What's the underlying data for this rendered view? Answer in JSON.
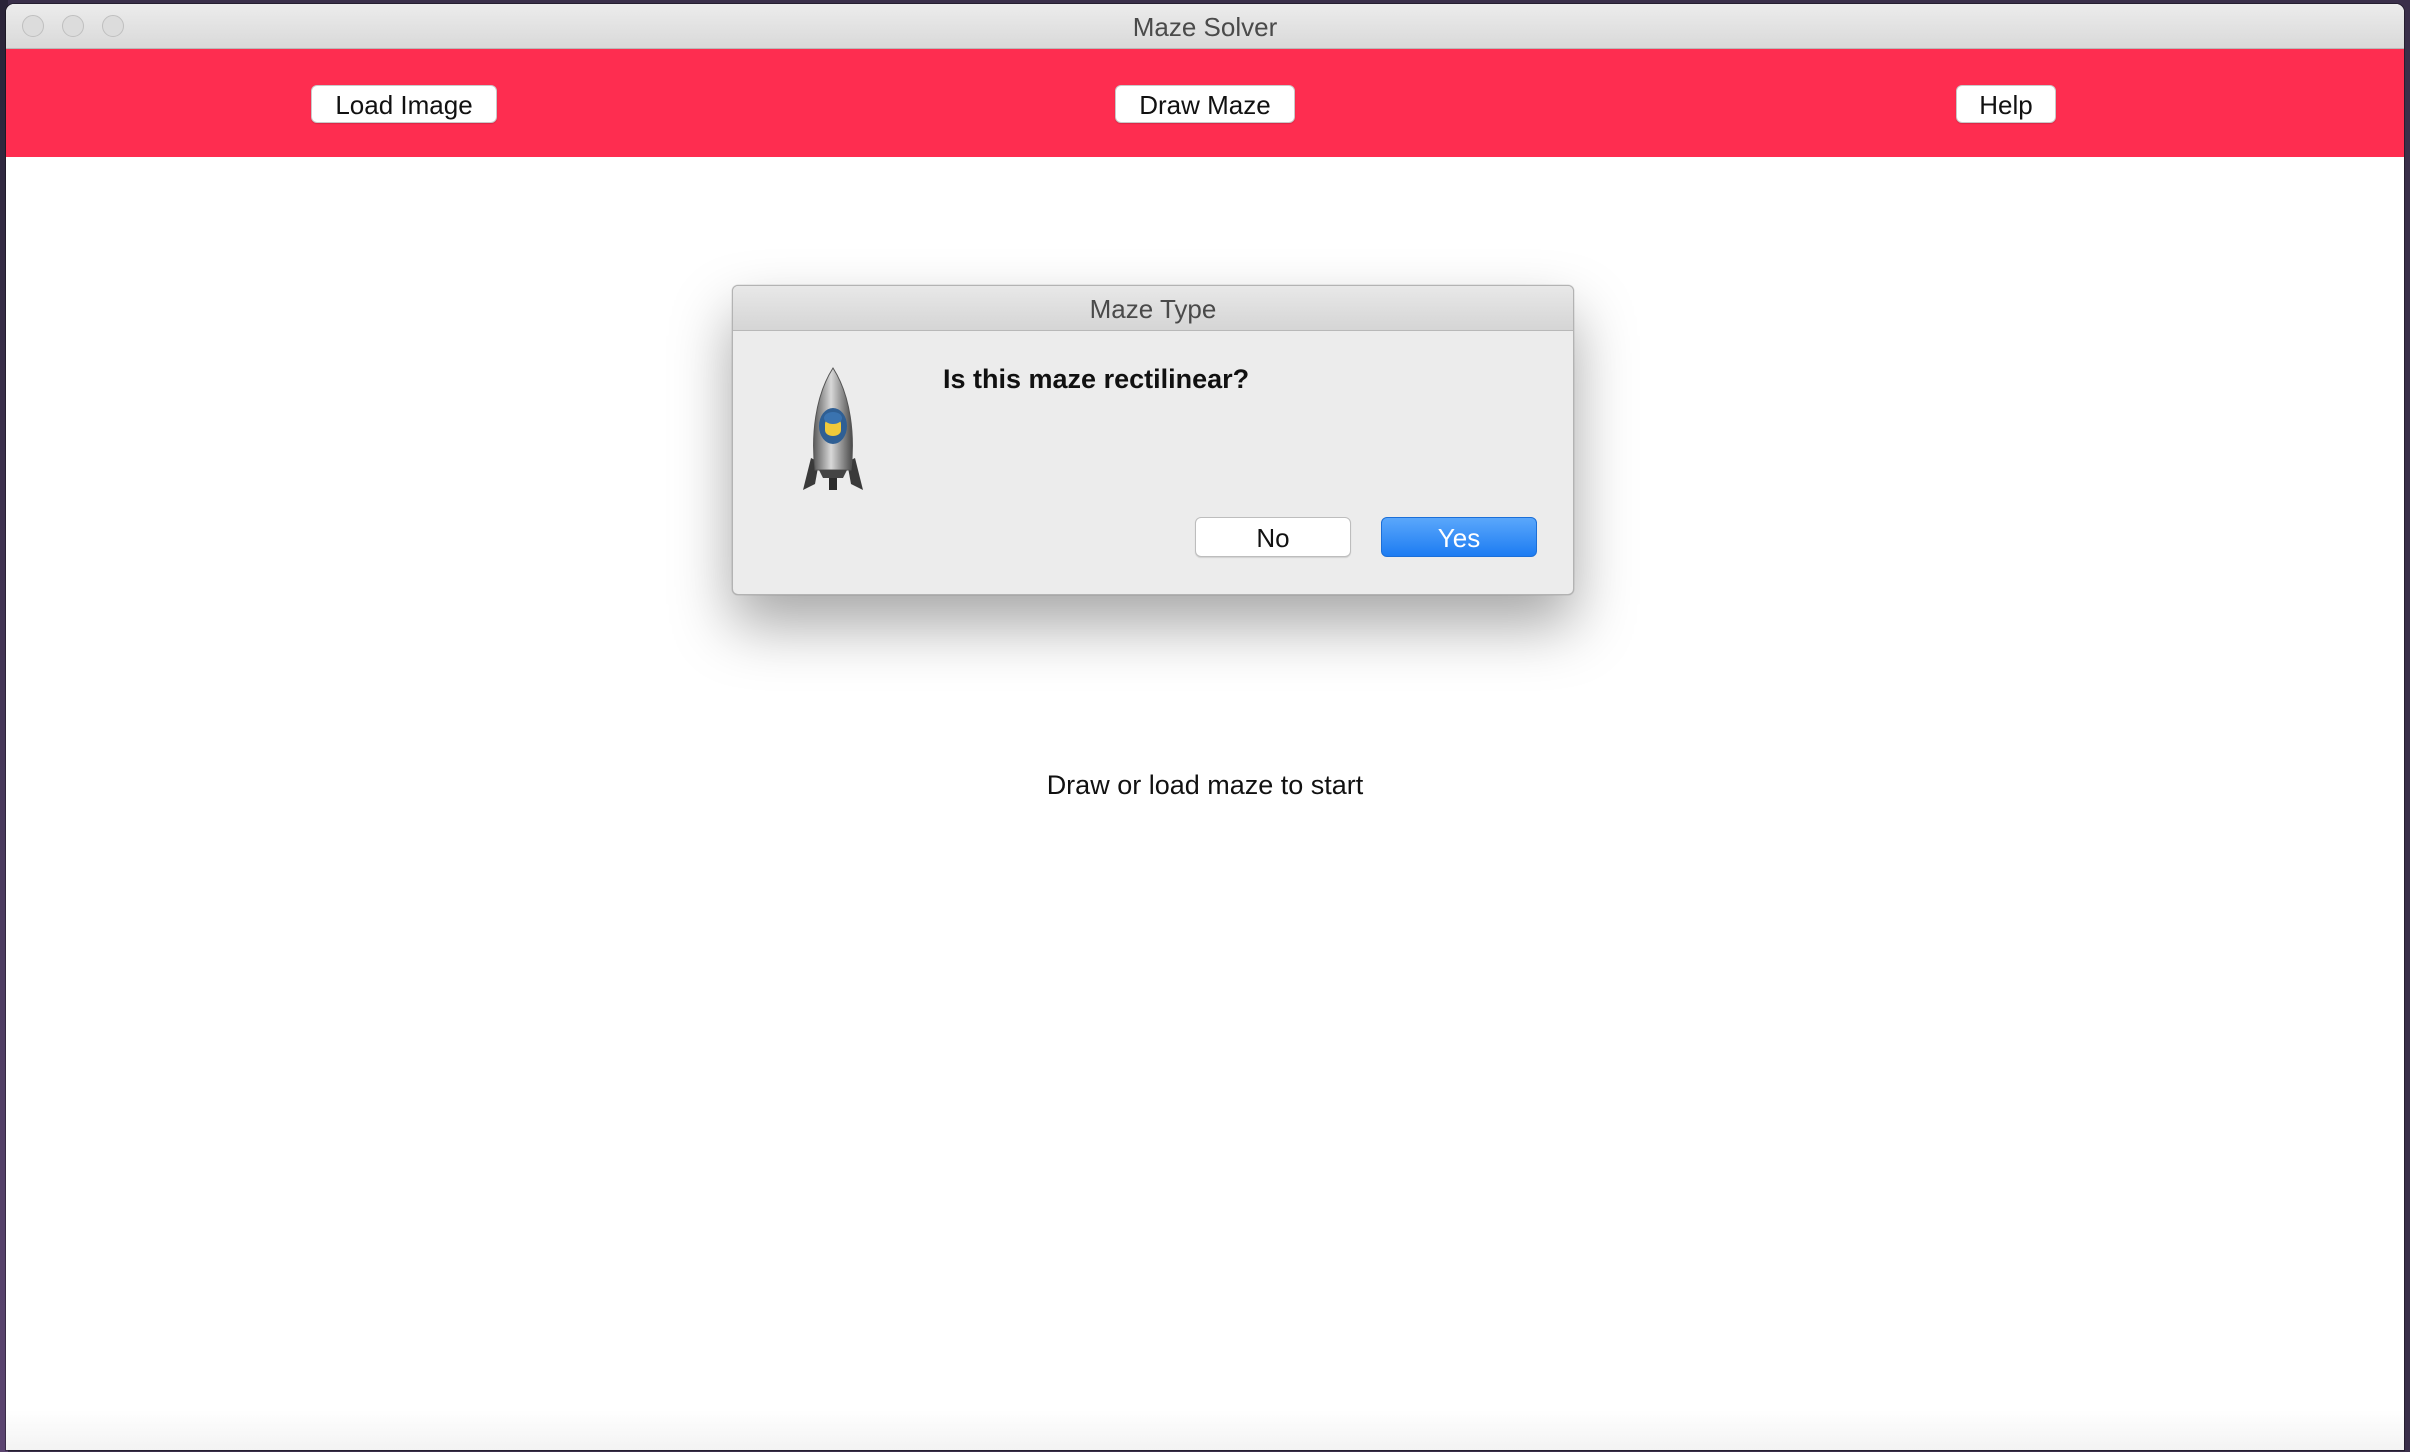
{
  "window": {
    "title": "Maze Solver"
  },
  "toolbar": {
    "load_image_label": "Load Image",
    "draw_maze_label": "Draw Maze",
    "help_label": "Help",
    "background_color": "#fe2d50"
  },
  "main": {
    "status_text": "Draw or load maze to start"
  },
  "dialog": {
    "title": "Maze Type",
    "message": "Is this maze rectilinear?",
    "icon": "python-launcher-rocket-icon",
    "no_label": "No",
    "yes_label": "Yes",
    "default_button_color": "#1d7cf2"
  }
}
